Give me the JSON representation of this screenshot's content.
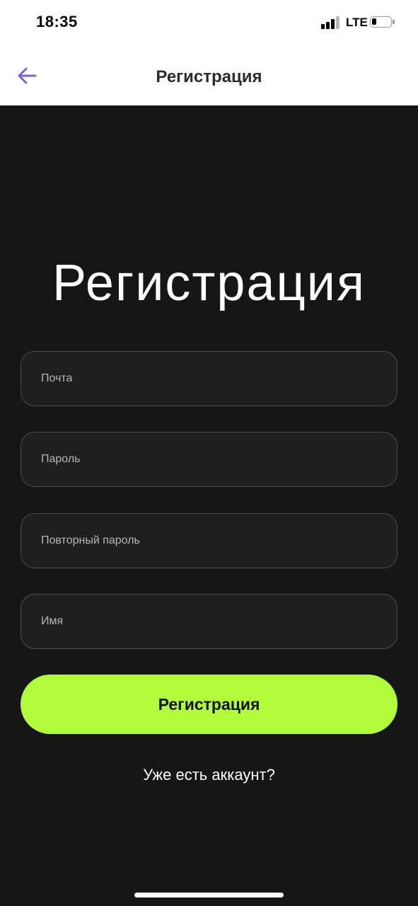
{
  "status_bar": {
    "time": "18:35",
    "network": "LTE",
    "signal_icon": "cellular-signal-icon",
    "battery_icon": "battery-icon",
    "battery_level": 0.2
  },
  "nav": {
    "back_icon": "arrow-left-icon",
    "title": "Регистрация"
  },
  "form": {
    "heading": "Регистрация",
    "fields": [
      {
        "placeholder": "Почта",
        "value": ""
      },
      {
        "placeholder": "Пароль",
        "value": ""
      },
      {
        "placeholder": "Повторный пароль",
        "value": ""
      },
      {
        "placeholder": "Имя",
        "value": ""
      }
    ],
    "submit_label": "Регистрация",
    "login_link": "Уже есть аккаунт?"
  },
  "colors": {
    "accent": "#b2fb3b",
    "back_arrow": "#7b66c8",
    "background": "#161616",
    "field_background": "#1f1f1f",
    "field_border": "#4c4c4c"
  }
}
